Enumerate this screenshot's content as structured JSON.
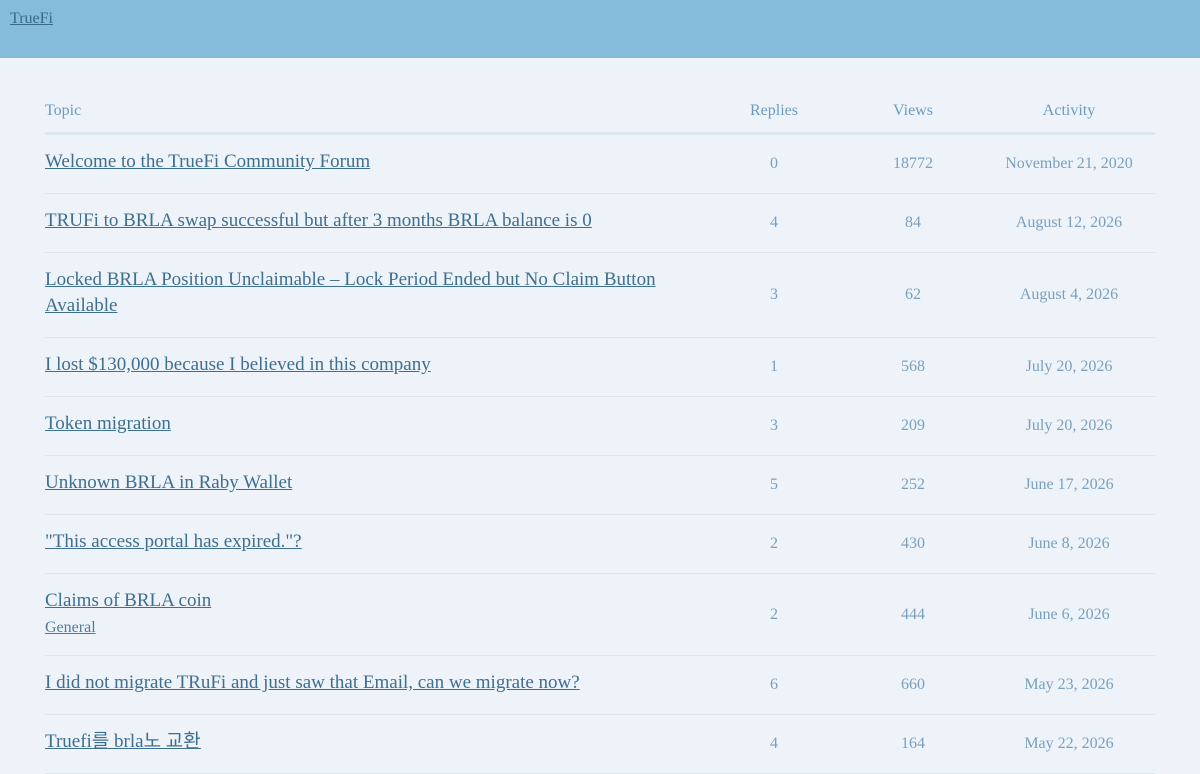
{
  "header": {
    "site_name": "TrueFi",
    "background": "#85bcdc"
  },
  "table": {
    "headers": {
      "topic": "Topic",
      "replies": "Replies",
      "views": "Views",
      "activity": "Activity"
    },
    "rows": [
      {
        "title": "Welcome to the TrueFi Community Forum",
        "category": "",
        "replies": "0",
        "views": "18772",
        "activity": "November 21, 2020"
      },
      {
        "title": "TRUFi to BRLA swap successful but after 3 months BRLA balance is 0",
        "category": "",
        "replies": "4",
        "views": "84",
        "activity": "August 12, 2026"
      },
      {
        "title": "Locked BRLA Position Unclaimable – Lock Period Ended but No Claim Button Available",
        "category": "",
        "replies": "3",
        "views": "62",
        "activity": "August 4, 2026"
      },
      {
        "title": "I lost $130,000 because I believed in this company",
        "category": "",
        "replies": "1",
        "views": "568",
        "activity": "July 20, 2026"
      },
      {
        "title": "Token migration",
        "category": "",
        "replies": "3",
        "views": "209",
        "activity": "July 20, 2026"
      },
      {
        "title": "Unknown BRLA in Raby Wallet",
        "category": "",
        "replies": "5",
        "views": "252",
        "activity": "June 17, 2026"
      },
      {
        "title": "\"This access portal has expired.\"?",
        "category": "",
        "replies": "2",
        "views": "430",
        "activity": "June 8, 2026"
      },
      {
        "title": "Claims of BRLA coin",
        "category": "General",
        "replies": "2",
        "views": "444",
        "activity": "June 6, 2026"
      },
      {
        "title": "I did not migrate TRuFi and just saw that Email, can we migrate now?",
        "category": "",
        "replies": "6",
        "views": "660",
        "activity": "May 23, 2026"
      },
      {
        "title": "Truefi를 brla노 교환",
        "category": "",
        "replies": "4",
        "views": "164",
        "activity": "May 22, 2026"
      }
    ]
  }
}
